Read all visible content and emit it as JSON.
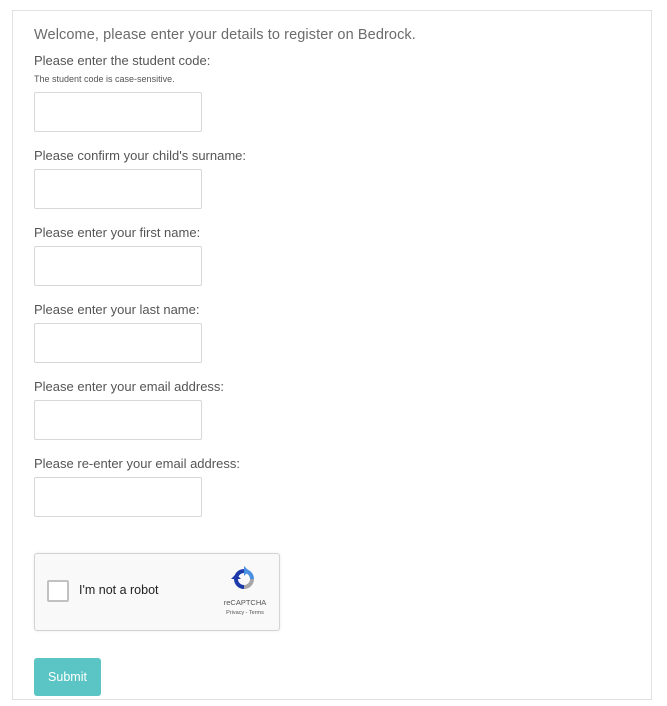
{
  "form": {
    "welcome": "Welcome, please enter your details to register on Bedrock.",
    "fields": [
      {
        "label": "Please enter the student code:",
        "hint": "The student code is case-sensitive.",
        "value": ""
      },
      {
        "label": "Please confirm your child's surname:",
        "value": ""
      },
      {
        "label": "Please enter your first name:",
        "value": ""
      },
      {
        "label": "Please enter your last name:",
        "value": ""
      },
      {
        "label": "Please enter your email address:",
        "value": ""
      },
      {
        "label": "Please re-enter your email address:",
        "value": ""
      }
    ],
    "submit_label": "Submit"
  },
  "captcha": {
    "label": "I'm not a robot",
    "brand": "reCAPTCHA",
    "privacy": "Privacy",
    "separator": " - ",
    "terms": "Terms",
    "checked": false
  },
  "colors": {
    "submit_bg": "#5bc4c4",
    "captcha_blue": "#1c3aa9",
    "captcha_lightblue": "#4a90e2",
    "captcha_grey": "#a6a6a6"
  }
}
